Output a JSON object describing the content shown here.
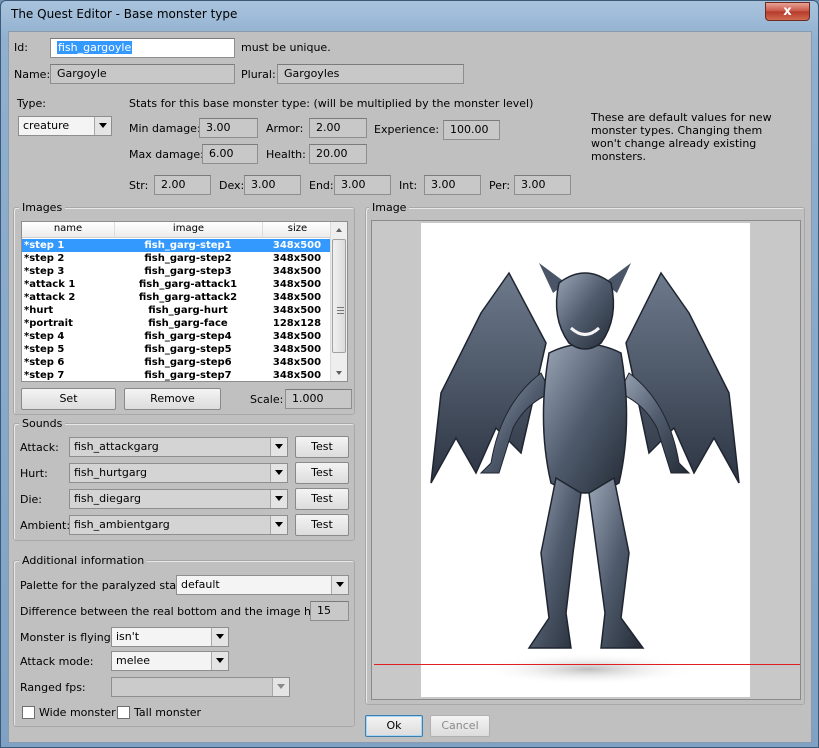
{
  "window": {
    "title": "The Quest Editor - Base monster type",
    "close_glyph": "x"
  },
  "identity": {
    "id_label": "Id:",
    "id_value": "fish_gargoyle",
    "id_note": "must be unique.",
    "name_label": "Name:",
    "name_value": "Gargoyle",
    "plural_label": "Plural:",
    "plural_value": "Gargoyles"
  },
  "type": {
    "label": "Type:",
    "value": "creature"
  },
  "stats": {
    "heading": "Stats for this base monster type: (will be multiplied by the monster level)",
    "min_damage_label": "Min damage:",
    "min_damage": "3.00",
    "armor_label": "Armor:",
    "armor": "2.00",
    "experience_label": "Experience:",
    "experience": "100.00",
    "max_damage_label": "Max damage:",
    "max_damage": "6.00",
    "health_label": "Health:",
    "health": "20.00",
    "str_label": "Str:",
    "str": "2.00",
    "dex_label": "Dex:",
    "dex": "3.00",
    "end_label": "End:",
    "end": "3.00",
    "int_label": "Int:",
    "int": "3.00",
    "per_label": "Per:",
    "per": "3.00",
    "note": "These are default values for new monster types. Changing them won't change already existing monsters."
  },
  "images": {
    "group_title": "Images",
    "columns": [
      "name",
      "image",
      "size"
    ],
    "rows": [
      {
        "name": "*step 1",
        "image": "fish_garg-step1",
        "size": "348x500"
      },
      {
        "name": "*step 2",
        "image": "fish_garg-step2",
        "size": "348x500"
      },
      {
        "name": "*step 3",
        "image": "fish_garg-step3",
        "size": "348x500"
      },
      {
        "name": "*attack 1",
        "image": "fish_garg-attack1",
        "size": "348x500"
      },
      {
        "name": "*attack 2",
        "image": "fish_garg-attack2",
        "size": "348x500"
      },
      {
        "name": "*hurt",
        "image": "fish_garg-hurt",
        "size": "348x500"
      },
      {
        "name": "*portrait",
        "image": "fish_garg-face",
        "size": "128x128"
      },
      {
        "name": "*step 4",
        "image": "fish_garg-step4",
        "size": "348x500"
      },
      {
        "name": "*step 5",
        "image": "fish_garg-step5",
        "size": "348x500"
      },
      {
        "name": "*step 6",
        "image": "fish_garg-step6",
        "size": "348x500"
      },
      {
        "name": "*step 7",
        "image": "fish_garg-step7",
        "size": "348x500"
      }
    ],
    "selected_row": 0,
    "set_label": "Set",
    "remove_label": "Remove",
    "scale_label": "Scale:",
    "scale_value": "1.000"
  },
  "sounds": {
    "group_title": "Sounds",
    "test_label": "Test",
    "items": [
      {
        "label": "Attack:",
        "value": "fish_attackgarg"
      },
      {
        "label": "Hurt:",
        "value": "fish_hurtgarg"
      },
      {
        "label": "Die:",
        "value": "fish_diegarg"
      },
      {
        "label": "Ambient:",
        "value": "fish_ambientgarg"
      }
    ]
  },
  "additional": {
    "group_title": "Additional information",
    "palette_label": "Palette for the paralyzed state:",
    "palette_value": "default",
    "bottom_diff_label": "Difference between the real bottom and the image height:",
    "bottom_diff_value": "15",
    "flying_label": "Monster is flying:",
    "flying_value": "isn't",
    "attack_mode_label": "Attack mode:",
    "attack_mode_value": "melee",
    "ranged_fps_label": "Ranged fps:",
    "ranged_fps_value": "",
    "wide_label": "Wide monster",
    "wide_checked": false,
    "tall_label": "Tall monster",
    "tall_checked": false
  },
  "preview": {
    "group_title": "Image",
    "baseline_color": "#e02020"
  },
  "footer": {
    "ok_label": "Ok",
    "cancel_label": "Cancel"
  },
  "colors": {
    "selection": "#3399ff",
    "window_frame": "#8fb0cf"
  }
}
